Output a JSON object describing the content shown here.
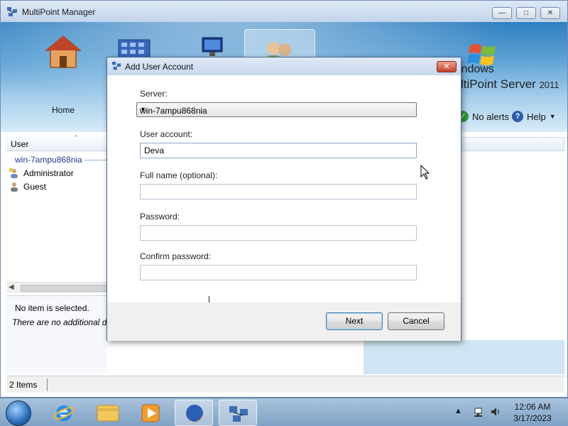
{
  "main_window": {
    "title": "MultiPoint Manager",
    "controls": {
      "minimize": "—",
      "maximize": "□",
      "close": "✕"
    },
    "nav": {
      "home_label": "Home"
    },
    "brand": {
      "line1": "indows",
      "line2_main": "ltiPoint Server",
      "line2_year": "2011"
    },
    "alerts_label": "No alerts",
    "help_label": "Help",
    "left_pane": {
      "column_header": "User",
      "server": "win-7ampu868nia",
      "users": [
        "Administrator",
        "Guest"
      ]
    },
    "details": {
      "none_selected": "No item is selected.",
      "no_info": "There are no additional de"
    },
    "status": {
      "items": "2 Items"
    }
  },
  "dialog": {
    "title": "Add User Account",
    "server_label": "Server:",
    "server_value": "win-7ampu868nia",
    "user_account_label": "User account:",
    "user_account_value": "Deva",
    "full_name_label": "Full name (optional):",
    "full_name_value": "",
    "password_label": "Password:",
    "password_value": "",
    "confirm_label": "Confirm password:",
    "confirm_value": "",
    "next_label": "Next",
    "cancel_label": "Cancel",
    "close_glyph": "✕"
  },
  "taskbar": {
    "tray": "▲",
    "time": "12:06 AM",
    "date": "3/17/2023"
  },
  "icons": [
    "multipoint-icon",
    "home-icon",
    "monitor-icon",
    "users-icon",
    "windows-flag-icon",
    "alert-icon",
    "help-icon",
    "admin-user-icon",
    "guest-user-icon",
    "start-orb-icon",
    "ie-icon",
    "explorer-icon",
    "media-player-icon",
    "firefox-icon",
    "multipoint-taskbar-icon",
    "network-icon",
    "volume-icon",
    "mouse-cursor-icon"
  ],
  "colors": {
    "ribbon": "#2f7fc1",
    "dialog_close": "#c4432a",
    "link": "#1a3e8c"
  }
}
